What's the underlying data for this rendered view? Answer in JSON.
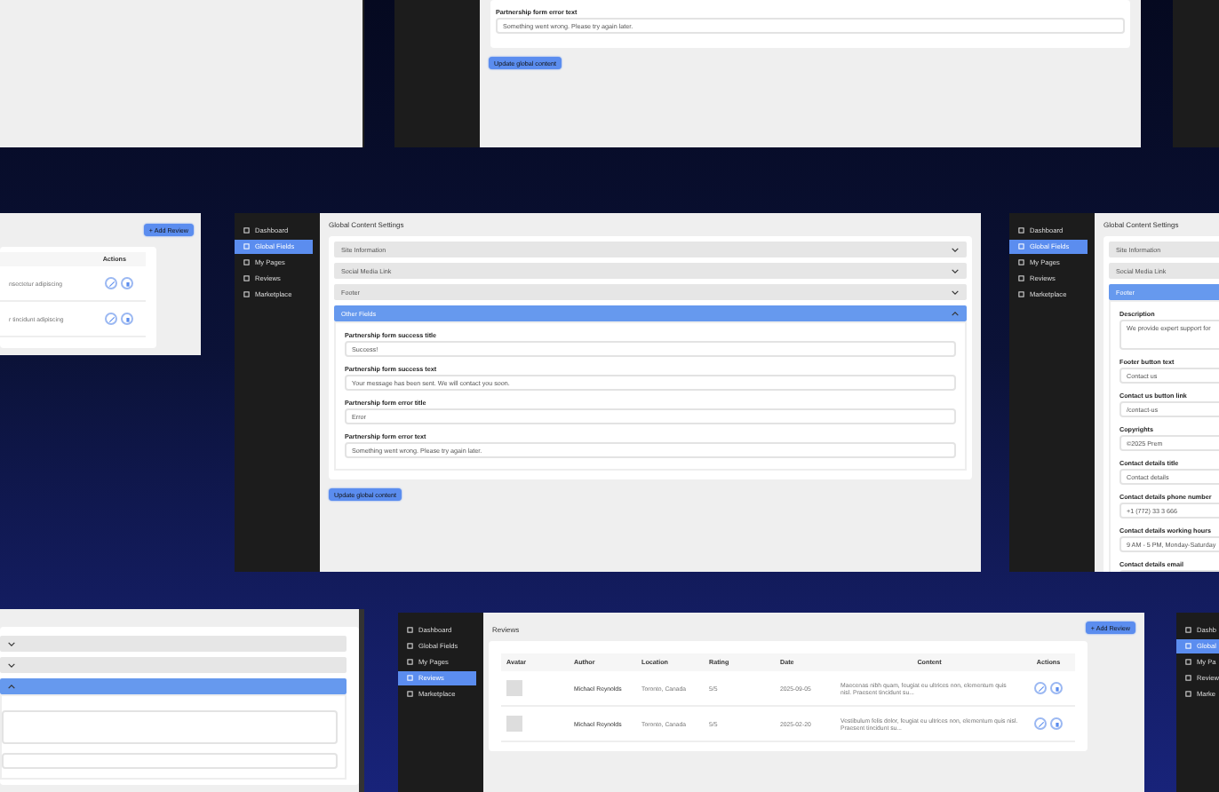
{
  "top_panel": {
    "field_label": "Partnership form error text",
    "field_value": "Something went wrong. Please try again later.",
    "button": "Update global content"
  },
  "left_reviews_panel": {
    "add_button": "+ Add Review",
    "actions_header": "Actions",
    "rows": [
      {
        "content": "nsectetur adipiscing"
      },
      {
        "content": "r tincidunt adipiscing"
      }
    ]
  },
  "center_panel": {
    "sidebar": [
      {
        "label": "Dashboard",
        "selected": false
      },
      {
        "label": "Global Fields",
        "selected": true
      },
      {
        "label": "My Pages",
        "selected": false
      },
      {
        "label": "Reviews",
        "selected": false
      },
      {
        "label": "Marketplace",
        "selected": false
      }
    ],
    "title": "Global Content Settings",
    "sections": [
      {
        "label": "Site Information",
        "expanded": false
      },
      {
        "label": "Social Media Link",
        "expanded": false
      },
      {
        "label": "Footer",
        "expanded": false
      },
      {
        "label": "Other Fields",
        "expanded": true
      }
    ],
    "fields": [
      {
        "label": "Partnership form success title",
        "value": "Success!"
      },
      {
        "label": "Partnership form success text",
        "value": "Your message has been sent. We will contact you soon."
      },
      {
        "label": "Partnership form error title",
        "value": "Error"
      },
      {
        "label": "Partnership form error text",
        "value": "Something went wrong. Please try again later."
      }
    ],
    "button": "Update global content"
  },
  "right_panel": {
    "sidebar": [
      {
        "label": "Dashboard",
        "selected": false
      },
      {
        "label": "Global Fields",
        "selected": true
      },
      {
        "label": "My Pages",
        "selected": false
      },
      {
        "label": "Reviews",
        "selected": false
      },
      {
        "label": "Marketplace",
        "selected": false
      }
    ],
    "title": "Global Content Settings",
    "sections": [
      {
        "label": "Site Information",
        "expanded": false
      },
      {
        "label": "Social Media Link",
        "expanded": false
      },
      {
        "label": "Footer",
        "expanded": true
      }
    ],
    "fields": [
      {
        "kind": "textarea",
        "label": "Description",
        "value": "We provide expert support for"
      },
      {
        "kind": "input",
        "label": "Footer button text",
        "value": "Contact us"
      },
      {
        "kind": "input",
        "label": "Contact us button link",
        "value": "/contact-us"
      },
      {
        "kind": "input",
        "label": "Copyrights",
        "value": "©2025 Prem"
      },
      {
        "kind": "input",
        "label": "Contact details title",
        "value": "Contact details"
      },
      {
        "kind": "input",
        "label": "Contact details phone number",
        "value": "+1 (772) 33 3 666"
      },
      {
        "kind": "input",
        "label": "Contact details working hours",
        "value": "9 AM - 5 PM, Monday-Saturday"
      },
      {
        "kind": "input",
        "label": "Contact details email"
      }
    ]
  },
  "bottom_left_panel": {
    "sections": [
      {
        "expanded": false
      },
      {
        "expanded": false
      },
      {
        "expanded": true
      }
    ]
  },
  "bottom_panel": {
    "sidebar": [
      {
        "label": "Dashboard",
        "selected": false
      },
      {
        "label": "Global Fields",
        "selected": false
      },
      {
        "label": "My Pages",
        "selected": false
      },
      {
        "label": "Reviews",
        "selected": true
      },
      {
        "label": "Marketplace",
        "selected": false
      }
    ],
    "title": "Reviews",
    "add_button": "+ Add Review",
    "columns": [
      "Avatar",
      "Author",
      "Location",
      "Rating",
      "Date",
      "Content",
      "Actions"
    ],
    "rows": [
      {
        "author": "Michael Reynolds",
        "location": "Toronto, Canada",
        "rating": "5/5",
        "date": "2025-09-05",
        "content": "Maecenas nibh quam, feugiat eu ultrices non, elementum quis nisl. Praesent tincidunt su..."
      },
      {
        "author": "Michael Reynolds",
        "location": "Toronto, Canada",
        "rating": "5/5",
        "date": "2025-02-20",
        "content": "Vestibulum felis dolor, feugiat eu ultrices non, elementum quis nisl. Praesent tincidunt su..."
      }
    ]
  },
  "bottom_right_panel": {
    "sidebar": [
      {
        "label": "Dashb",
        "selected": false
      },
      {
        "label": "Global",
        "selected": true
      },
      {
        "label": "My Pa",
        "selected": false
      },
      {
        "label": "Review",
        "selected": false
      },
      {
        "label": "Marke",
        "selected": false
      }
    ]
  }
}
